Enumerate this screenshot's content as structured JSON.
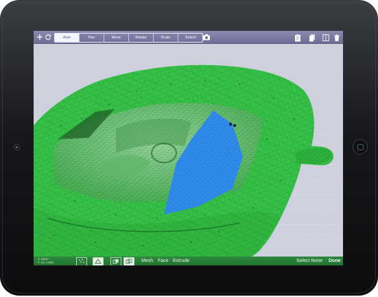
{
  "toolbar": {
    "add_icon": "plus-icon",
    "refresh_icon": "refresh-icon",
    "modes": [
      {
        "label": "Auto",
        "active": true
      },
      {
        "label": "Pan",
        "active": false
      },
      {
        "label": "Move",
        "active": false
      },
      {
        "label": "Rotate",
        "active": false
      },
      {
        "label": "Scale",
        "active": false
      },
      {
        "label": "Select",
        "active": false
      }
    ],
    "camera_icon": "camera-icon",
    "right_icons": [
      "clipboard-icon",
      "document-stack-icon",
      "split-view-icon",
      "trash-icon"
    ]
  },
  "status": {
    "vertices": "V: 15227",
    "faces": "F: 16 | 13181"
  },
  "bottom": {
    "select_modes": [
      "Mesh",
      "Face",
      "Extrude"
    ],
    "select_none": "Select None",
    "done": "Done"
  },
  "colors": {
    "mesh": "#33c045",
    "selection": "#2f8cf0",
    "toolbar": "#7a79a3",
    "bottombar": "#2a7f37",
    "background": "#cfd0de"
  }
}
